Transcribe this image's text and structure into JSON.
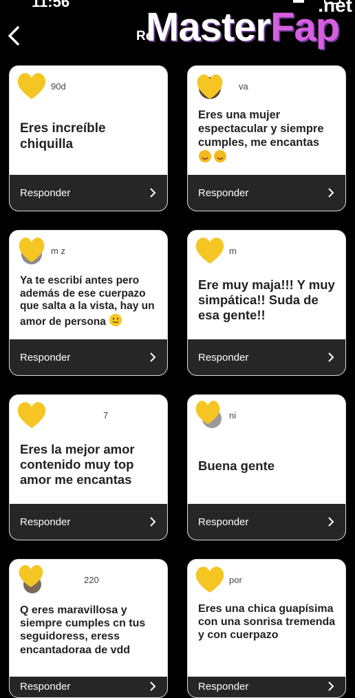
{
  "status": {
    "time": "11:56"
  },
  "header": {
    "title": "Respuestas",
    "title_visible": "Re"
  },
  "watermark": {
    "main": "Master",
    "accent": "Fap",
    "suffix": ".net"
  },
  "cards": [
    {
      "handle": "90d",
      "message": "Eres increíble chiquilla",
      "reply_label": "Responder"
    },
    {
      "handle": "va",
      "message": "Eres una mujer espectacular y siempre cumples, me encantas",
      "reply_label": "Responder"
    },
    {
      "handle": "m  z",
      "message": "Ya te escribí antes pero además de ese cuerpazo que salta a la vista, hay un amor de persona",
      "reply_label": "Responder"
    },
    {
      "handle": "m",
      "message": "Ere muy maja!!! Y muy simpática!! Suda de esa gente!!",
      "reply_label": "Responder"
    },
    {
      "handle": "7",
      "message": "Eres la mejor amor contenido muy top amor me encantas",
      "reply_label": "Responder"
    },
    {
      "handle": "ni",
      "message": "Buena gente",
      "reply_label": "Responder"
    },
    {
      "handle": "220",
      "message": "Q eres maravillosa y siempre cumples cn tus seguidoress, eress encantadoraa de vdd",
      "reply_label": "Responder"
    },
    {
      "handle": "por",
      "message": "Eres una chica guapísima con una sonrisa tremenda y con cuerpazo",
      "reply_label": "Responder"
    }
  ]
}
